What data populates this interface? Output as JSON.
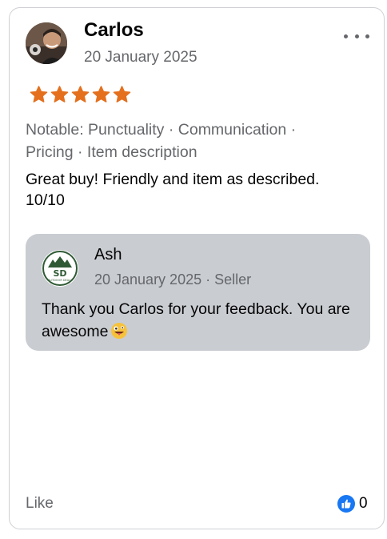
{
  "review": {
    "author": "Carlos",
    "date": "20 January 2025",
    "rating": 5,
    "notable": "Notable: Punctuality · Communication · Pricing · Item description",
    "comment": "Great buy! Friendly and item as described. 10/10"
  },
  "reply": {
    "author": "Ash",
    "meta": "20 January 2025 · Seller",
    "text": "Thank you Carlos for your feedback. You are awesome",
    "logo_text": "SD",
    "logo_subtext": "OUTDOOR DEALS"
  },
  "footer": {
    "like_label": "Like",
    "like_count": "0"
  },
  "colors": {
    "star": "#e4701e",
    "reply_bg": "#c9ccd1",
    "like_blue": "#1877f2",
    "secondary_text": "#65676b"
  }
}
